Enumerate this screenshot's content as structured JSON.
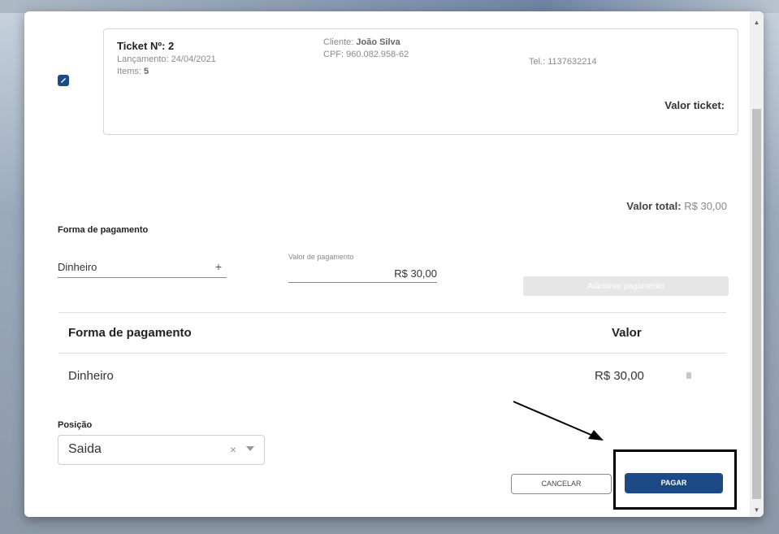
{
  "ticket": {
    "number_label": "Ticket Nº: 2",
    "release_label": "Lançamento: 24/04/2021",
    "items_label": "Items:",
    "items_count": "5",
    "client_label": "Cliente:",
    "client_name": "João Silva",
    "cpf": "CPF: 960.082.958-62",
    "phone": "Tel.: 1137632214",
    "valor_ticket_label": "Valor ticket:"
  },
  "total": {
    "label": "Valor total:",
    "amount": "R$ 30,00"
  },
  "payment_form": {
    "section_label": "Forma de pagamento",
    "method_value": "Dinheiro",
    "add_symbol": "+",
    "amount_label": "Valor de pagamento",
    "amount_value": "R$ 30,00",
    "add_button": "Adicionar pagamento"
  },
  "payments_table": {
    "headers": [
      "Forma de pagamento",
      "Valor"
    ],
    "rows": [
      {
        "method": "Dinheiro",
        "value": "R$ 30,00"
      }
    ]
  },
  "position": {
    "label": "Posição",
    "value": "Saida",
    "clear_symbol": "×"
  },
  "actions": {
    "cancel": "CANCELAR",
    "pay": "PAGAR"
  },
  "colors": {
    "primary": "#1c4a86",
    "disabled": "#e6e6e6"
  }
}
